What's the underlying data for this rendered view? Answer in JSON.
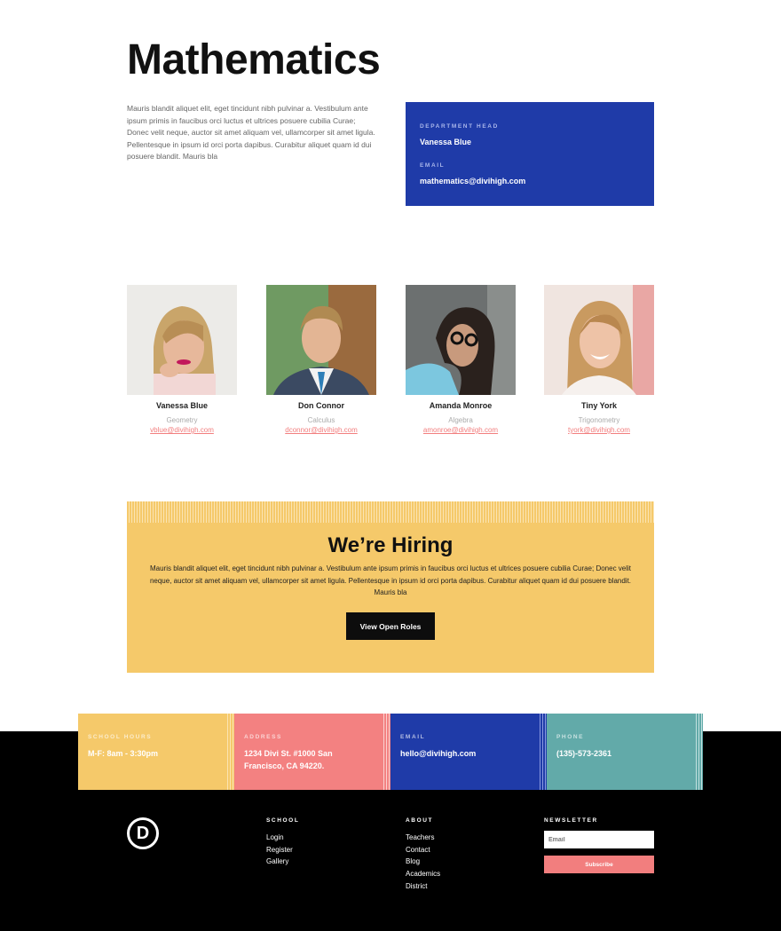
{
  "page": {
    "title": "Mathematics",
    "intro": "Mauris blandit aliquet elit, eget tincidunt nibh pulvinar a. Vestibulum ante ipsum primis in faucibus orci luctus et ultrices posuere cubilia Curae; Donec velit neque, auctor sit amet aliquam vel, ullamcorper sit amet ligula. Pellentesque in ipsum id orci porta dapibus. Curabitur aliquet quam id dui posuere blandit. Mauris bla"
  },
  "department": {
    "head_label": "DEPARTMENT HEAD",
    "head_value": "Vanessa Blue",
    "email_label": "EMAIL",
    "email_value": "mathematics@divihigh.com"
  },
  "team": [
    {
      "name": "Vanessa Blue",
      "subject": "Geometry",
      "email": "vblue@divihigh.com"
    },
    {
      "name": "Don Connor",
      "subject": "Calculus",
      "email": "dconnor@divihigh.com"
    },
    {
      "name": "Amanda Monroe",
      "subject": "Algebra",
      "email": "amonroe@divihigh.com"
    },
    {
      "name": "Tiny York",
      "subject": "Trigonometry",
      "email": "tyork@divihigh.com"
    }
  ],
  "hiring": {
    "title": "We’re Hiring",
    "text": "Mauris blandit aliquet elit, eget tincidunt nibh pulvinar a. Vestibulum ante ipsum primis in faucibus orci luctus et ultrices posuere cubilia Curae; Donec velit neque, auctor sit amet aliquam vel, ullamcorper sit amet ligula. Pellentesque in ipsum id orci porta dapibus. Curabitur aliquet quam id dui posuere blandit. Mauris bla",
    "button": "View Open Roles"
  },
  "info": [
    {
      "label": "SCHOOL HOURS",
      "value": "M-F: 8am - 3:30pm",
      "color": "#f5c96a"
    },
    {
      "label": "ADDRESS",
      "value": "1234 Divi St. #1000 San Francisco, CA 94220.",
      "color": "#f38181"
    },
    {
      "label": "EMAIL",
      "value": "hello@divihigh.com",
      "color": "#1f3ba8"
    },
    {
      "label": "PHONE",
      "value": "(135)-573-2361",
      "color": "#62aaa9"
    }
  ],
  "footer": {
    "logo": "D",
    "school": {
      "heading": "SCHOOL",
      "links": [
        "Login",
        "Register",
        "Gallery"
      ]
    },
    "about": {
      "heading": "ABOUT",
      "links": [
        "Teachers",
        "Contact",
        "Blog",
        "Academics",
        "District"
      ]
    },
    "newsletter": {
      "heading": "NEWSLETTER",
      "placeholder": "Email",
      "button": "Subscribe"
    }
  },
  "colors": {
    "accent_blue": "#1f3ba8",
    "accent_yellow": "#f5c96a",
    "accent_coral": "#f38181",
    "accent_teal": "#62aaa9"
  }
}
